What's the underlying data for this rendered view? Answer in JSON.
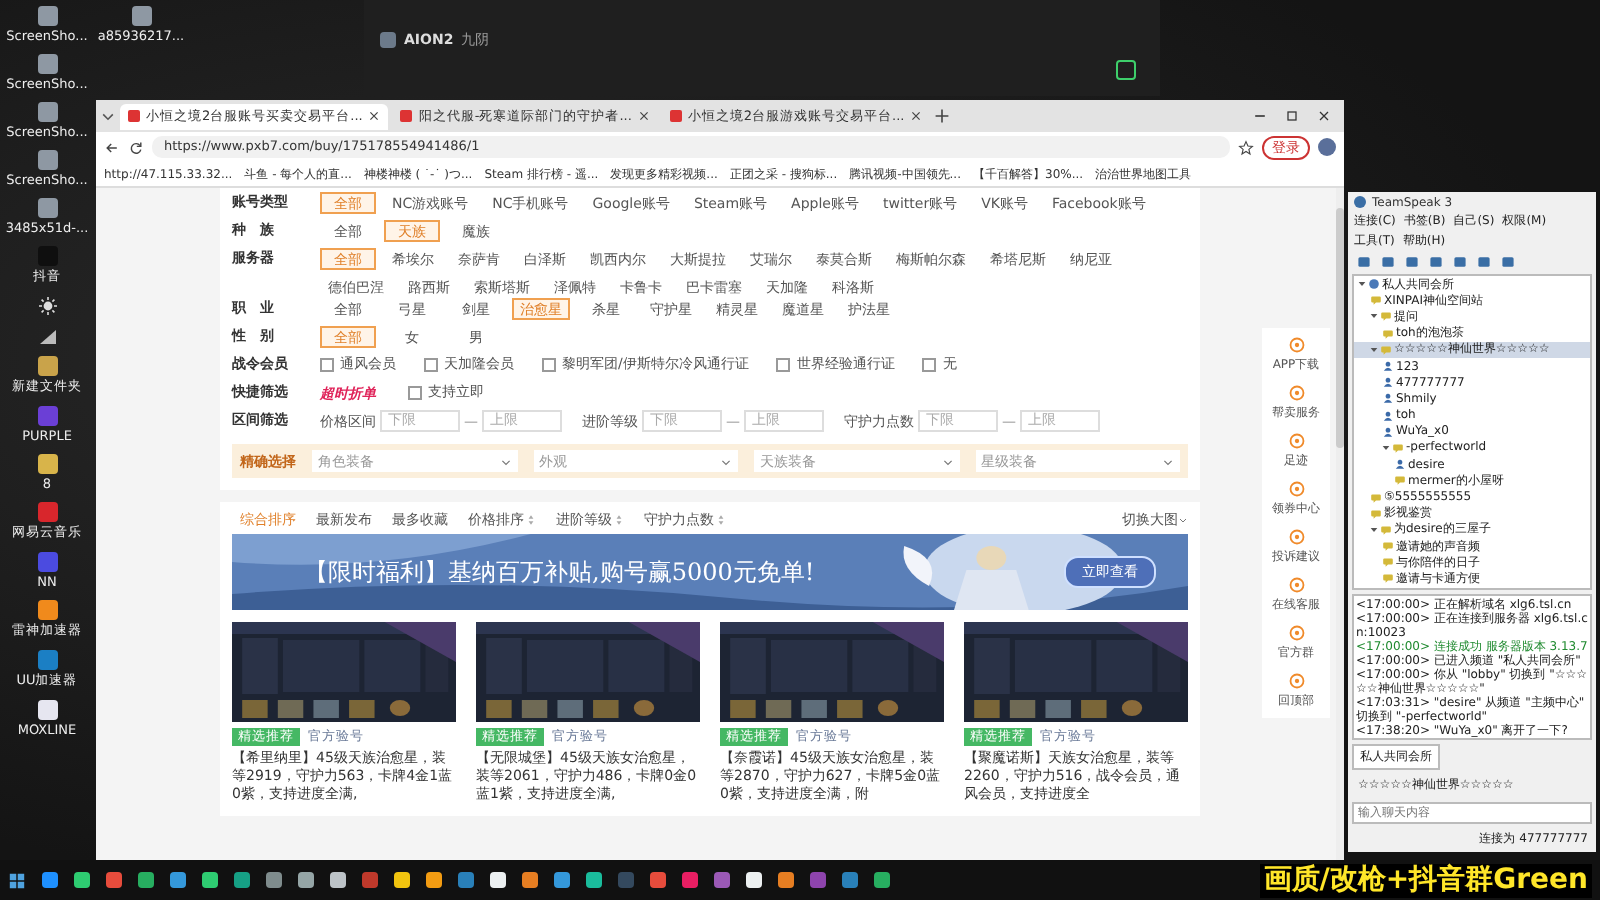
{
  "desktop_icons": [
    {
      "label": "ScreenSho...",
      "kind": "file"
    },
    {
      "label": "a85936217...",
      "kind": "file"
    },
    {
      "label": "ScreenSho...",
      "kind": "file"
    },
    {
      "label": "ScreenSho...",
      "kind": "file"
    },
    {
      "label": "ScreenSho...",
      "kind": "file"
    },
    {
      "label": "3485x51d-...",
      "kind": "file"
    },
    {
      "label": "抖音",
      "kind": "tiktok"
    },
    {
      "kind": "brightness"
    },
    {
      "kind": "signal"
    },
    {
      "label": "新建文件夹",
      "kind": "folder"
    },
    {
      "label": "PURPLE",
      "kind": "purple"
    },
    {
      "label": "8",
      "kind": "game"
    },
    {
      "label": "网易云音乐",
      "kind": "music"
    },
    {
      "label": "NN",
      "kind": "nn"
    },
    {
      "label": "雷神加速器",
      "kind": "thunder"
    },
    {
      "label": "UU加速器",
      "kind": "uu"
    },
    {
      "label": "MOXLINE",
      "kind": "moxline"
    }
  ],
  "game_window": {
    "title": "AION2",
    "subtitle": "九阴"
  },
  "browser": {
    "tabs": [
      {
        "title": "小恒之境2台服账号买卖交易平台...",
        "selected": true
      },
      {
        "title": "阳之代服-死寒道际部门的守护者...",
        "selected": false
      },
      {
        "title": "小恒之境2台服游戏账号交易平台...",
        "selected": false
      }
    ],
    "url": "https://www.pxb7.com/buy/175178554941486/1",
    "login": "登录",
    "bookmarks": [
      "http://47.115.33.32...",
      "斗鱼 - 每个人的直...",
      "神楼神楼 ( ˙-˙ )つ...",
      "Steam 排行榜 - 遥...",
      "发现更多精彩视频...",
      "正团之采 - 搜狗标...",
      "腾讯视频-中国领先...",
      "【千百解答】30%...",
      "治治世界地图工具"
    ]
  },
  "filters": [
    {
      "kind": "tags",
      "label": "账号类型",
      "options": [
        {
          "text": "全部",
          "selected": true
        },
        {
          "text": "NC游戏账号",
          "selected": false
        },
        {
          "text": "NC手机账号",
          "selected": false
        },
        {
          "text": "Google账号",
          "selected": false
        },
        {
          "text": "Steam账号",
          "selected": false
        },
        {
          "text": "Apple账号",
          "selected": false
        },
        {
          "text": "twitter账号",
          "selected": false
        },
        {
          "text": "VK账号",
          "selected": false
        },
        {
          "text": "Facebook账号",
          "selected": false
        }
      ]
    },
    {
      "kind": "tags",
      "label": "种　族",
      "options": [
        {
          "text": "全部",
          "selected": false
        },
        {
          "text": "天族",
          "selected": true
        },
        {
          "text": "魔族",
          "selected": false
        }
      ]
    },
    {
      "kind": "tags",
      "label": "服务器",
      "options": [
        {
          "text": "全部",
          "selected": true
        },
        {
          "text": "希埃尔",
          "selected": false
        },
        {
          "text": "奈萨肯",
          "selected": false
        },
        {
          "text": "白泽斯",
          "selected": false
        },
        {
          "text": "凯西内尔",
          "selected": false
        },
        {
          "text": "大斯提拉",
          "selected": false
        },
        {
          "text": "艾瑞尔",
          "selected": false
        },
        {
          "text": "泰莫合斯",
          "selected": false
        },
        {
          "text": "梅斯帕尔森",
          "selected": false
        },
        {
          "text": "希塔尼斯",
          "selected": false
        },
        {
          "text": "纳尼亚",
          "selected": false
        },
        {
          "text": "德伯巴涅",
          "selected": false
        },
        {
          "text": "路西斯",
          "selected": false
        },
        {
          "text": "索斯塔斯",
          "selected": false
        },
        {
          "text": "泽佩特",
          "selected": false
        },
        {
          "text": "卡鲁卡",
          "selected": false
        },
        {
          "text": "巴卡雷塞",
          "selected": false
        },
        {
          "text": "天加隆",
          "selected": false
        },
        {
          "text": "科洛斯",
          "selected": false
        }
      ]
    },
    {
      "kind": "tags",
      "label": "职　业",
      "options": [
        {
          "text": "全部",
          "selected": false
        },
        {
          "text": "弓星",
          "selected": false
        },
        {
          "text": "剑星",
          "selected": false
        },
        {
          "text": "治愈星",
          "selected": true
        },
        {
          "text": "杀星",
          "selected": false
        },
        {
          "text": "守护星",
          "selected": false
        },
        {
          "text": "精灵星",
          "selected": false
        },
        {
          "text": "魔道星",
          "selected": false
        },
        {
          "text": "护法星",
          "selected": false
        }
      ]
    },
    {
      "kind": "tags",
      "label": "性　别",
      "options": [
        {
          "text": "全部",
          "selected": true
        },
        {
          "text": "女",
          "selected": false
        },
        {
          "text": "男",
          "selected": false
        }
      ]
    },
    {
      "kind": "checks",
      "label": "战令会员",
      "options": [
        {
          "text": "通风会员",
          "checked": false
        },
        {
          "text": "天加隆会员",
          "checked": false
        },
        {
          "text": "黎明军团/伊斯特尔冷风通行证",
          "checked": false
        },
        {
          "text": "世界经验通行证",
          "checked": false
        },
        {
          "text": "无",
          "checked": false
        }
      ]
    },
    {
      "kind": "quick",
      "label": "快捷筛选",
      "badge": "超时折单",
      "options": [
        {
          "text": "支持立即",
          "checked": false
        }
      ]
    },
    {
      "kind": "range",
      "label": "区间筛选",
      "ranges": [
        {
          "label": "价格区间",
          "min": {
            "placeholder": "下限"
          },
          "dash": "—",
          "max": {
            "placeholder": "上限"
          }
        },
        {
          "label": "进阶等级",
          "min": {
            "placeholder": "下限"
          },
          "dash": "—",
          "max": {
            "placeholder": "上限"
          }
        },
        {
          "label": "守护力点数",
          "min": {
            "placeholder": "下限"
          },
          "dash": "—",
          "max": {
            "placeholder": "上限"
          }
        }
      ]
    }
  ],
  "precise": {
    "label": "精确选择",
    "dropdowns": [
      "角色装备",
      "外观",
      "天族装备",
      "星级装备"
    ]
  },
  "sort": {
    "options": [
      {
        "text": "综合排序",
        "selected": true,
        "sortable": false
      },
      {
        "text": "最新发布",
        "selected": false,
        "sortable": false
      },
      {
        "text": "最多收藏",
        "selected": false,
        "sortable": false
      },
      {
        "text": "价格排序",
        "selected": false,
        "sortable": true
      },
      {
        "text": "进阶等级",
        "selected": false,
        "sortable": true
      },
      {
        "text": "守护力点数",
        "selected": false,
        "sortable": true
      }
    ],
    "view": "切换大图"
  },
  "banner": {
    "text": "【限时福利】基纳百万补贴,购号赢5000元免单!",
    "button": "立即查看"
  },
  "listings": [
    {
      "tag": "精选推荐",
      "verify": "官方验号",
      "title": "【希里纳里】45级天族治愈星，装等2919，守护力563，卡牌4金1蓝0紫，支持进度全满,"
    },
    {
      "tag": "精选推荐",
      "verify": "官方验号",
      "title": "【无限城堡】45级天族女治愈星，装等2061，守护力486，卡牌0金0蓝1紫，支持进度全满,"
    },
    {
      "tag": "精选推荐",
      "verify": "官方验号",
      "title": "【奈霞诺】45级天族女治愈星，装等2870，守护力627，卡牌5金0蓝0紫，支持进度全满，附"
    },
    {
      "tag": "精选推荐",
      "verify": "官方验号",
      "title": "【聚魔诺斯】天族女治愈星，装等2260，守护力516，战令会员，通风会员，支持进度全"
    }
  ],
  "side_tools": [
    "APP下载",
    "帮卖服务",
    "足迹",
    "领券中心",
    "投诉建议",
    "在线客服",
    "官方群",
    "回顶部"
  ],
  "teamspeak": {
    "title": "TeamSpeak 3",
    "menu": [
      "连接(C)",
      "书签(B)",
      "自己(S)",
      "权限(M)",
      "工具(T)",
      "帮助(H)"
    ],
    "tree": [
      {
        "name": "私人共同会所",
        "kind": "server",
        "selected": false,
        "expanded": true,
        "children": [
          {
            "name": "XINPAI神仙空间站",
            "kind": "channel",
            "selected": false
          },
          {
            "name": "提问",
            "kind": "channel",
            "selected": false,
            "expanded": true,
            "children": [
              {
                "name": "toh的泡泡茶",
                "kind": "channel",
                "selected": false
              }
            ]
          },
          {
            "name": "☆☆☆☆☆神仙世界☆☆☆☆☆",
            "kind": "channel",
            "selected": true,
            "expanded": true,
            "children": [
              {
                "name": "123",
                "kind": "user",
                "selected": false
              },
              {
                "name": "477777777",
                "kind": "user",
                "selected": false
              },
              {
                "name": "Shmily",
                "kind": "user",
                "selected": false
              },
              {
                "name": "toh",
                "kind": "user",
                "selected": false
              },
              {
                "name": "WuYa_x0",
                "kind": "user",
                "selected": false
              },
              {
                "name": "-perfectworld",
                "kind": "channel",
                "selected": false,
                "expanded": true,
                "children": [
                  {
                    "name": "desire",
                    "kind": "user",
                    "selected": false
                  },
                  {
                    "name": "mermer的小屋呀",
                    "kind": "channel",
                    "selected": false
                  }
                ]
              }
            ]
          },
          {
            "name": "⑤5555555555",
            "kind": "channel",
            "selected": false
          },
          {
            "name": "影视鉴赏",
            "kind": "channel",
            "selected": false
          },
          {
            "name": "为desire的三屋子",
            "kind": "channel",
            "selected": false,
            "expanded": true,
            "children": [
              {
                "name": "邀请她的声音频",
                "kind": "channel",
                "selected": false
              },
              {
                "name": "与你陪伴的日子",
                "kind": "channel",
                "selected": false
              },
              {
                "name": "邀请与卡通方便",
                "kind": "channel",
                "selected": false
              }
            ]
          }
        ]
      }
    ],
    "log": [
      {
        "time": "<17:00:00>",
        "text": "正在解析域名 xlg6.tsl.cn",
        "kind": "info"
      },
      {
        "time": "<17:00:00>",
        "text": "正在连接到服务器 xlg6.tsl.cn:10023",
        "kind": "info"
      },
      {
        "time": "<17:00:00>",
        "text": "连接成功 服务器版本 3.13.7",
        "kind": "ok"
      },
      {
        "time": "<17:00:00>",
        "text": "已进入频道 \"私人共同会所\"",
        "kind": "info"
      },
      {
        "time": "<17:00:00>",
        "text": "你从 \"lobby\" 切换到 \"☆☆☆☆☆神仙世界☆☆☆☆☆\"",
        "kind": "info"
      },
      {
        "time": "<17:03:31>",
        "text": "\"desire\" 从频道 \"主频中心\" 切换到 \"-perfectworld\"",
        "kind": "info"
      },
      {
        "time": "<17:38:20>",
        "text": "\"WuYa_x0\" 离开了一下?",
        "kind": "info"
      }
    ],
    "tabs": [
      {
        "label": "私人共同会所",
        "selected": true
      },
      {
        "label": "☆☆☆☆☆神仙世界☆☆☆☆☆",
        "selected": false
      }
    ],
    "placeholder": "输入聊天内容",
    "status": "连接为 477777777"
  },
  "overlay_text": "画质/改枪+抖音群Green"
}
